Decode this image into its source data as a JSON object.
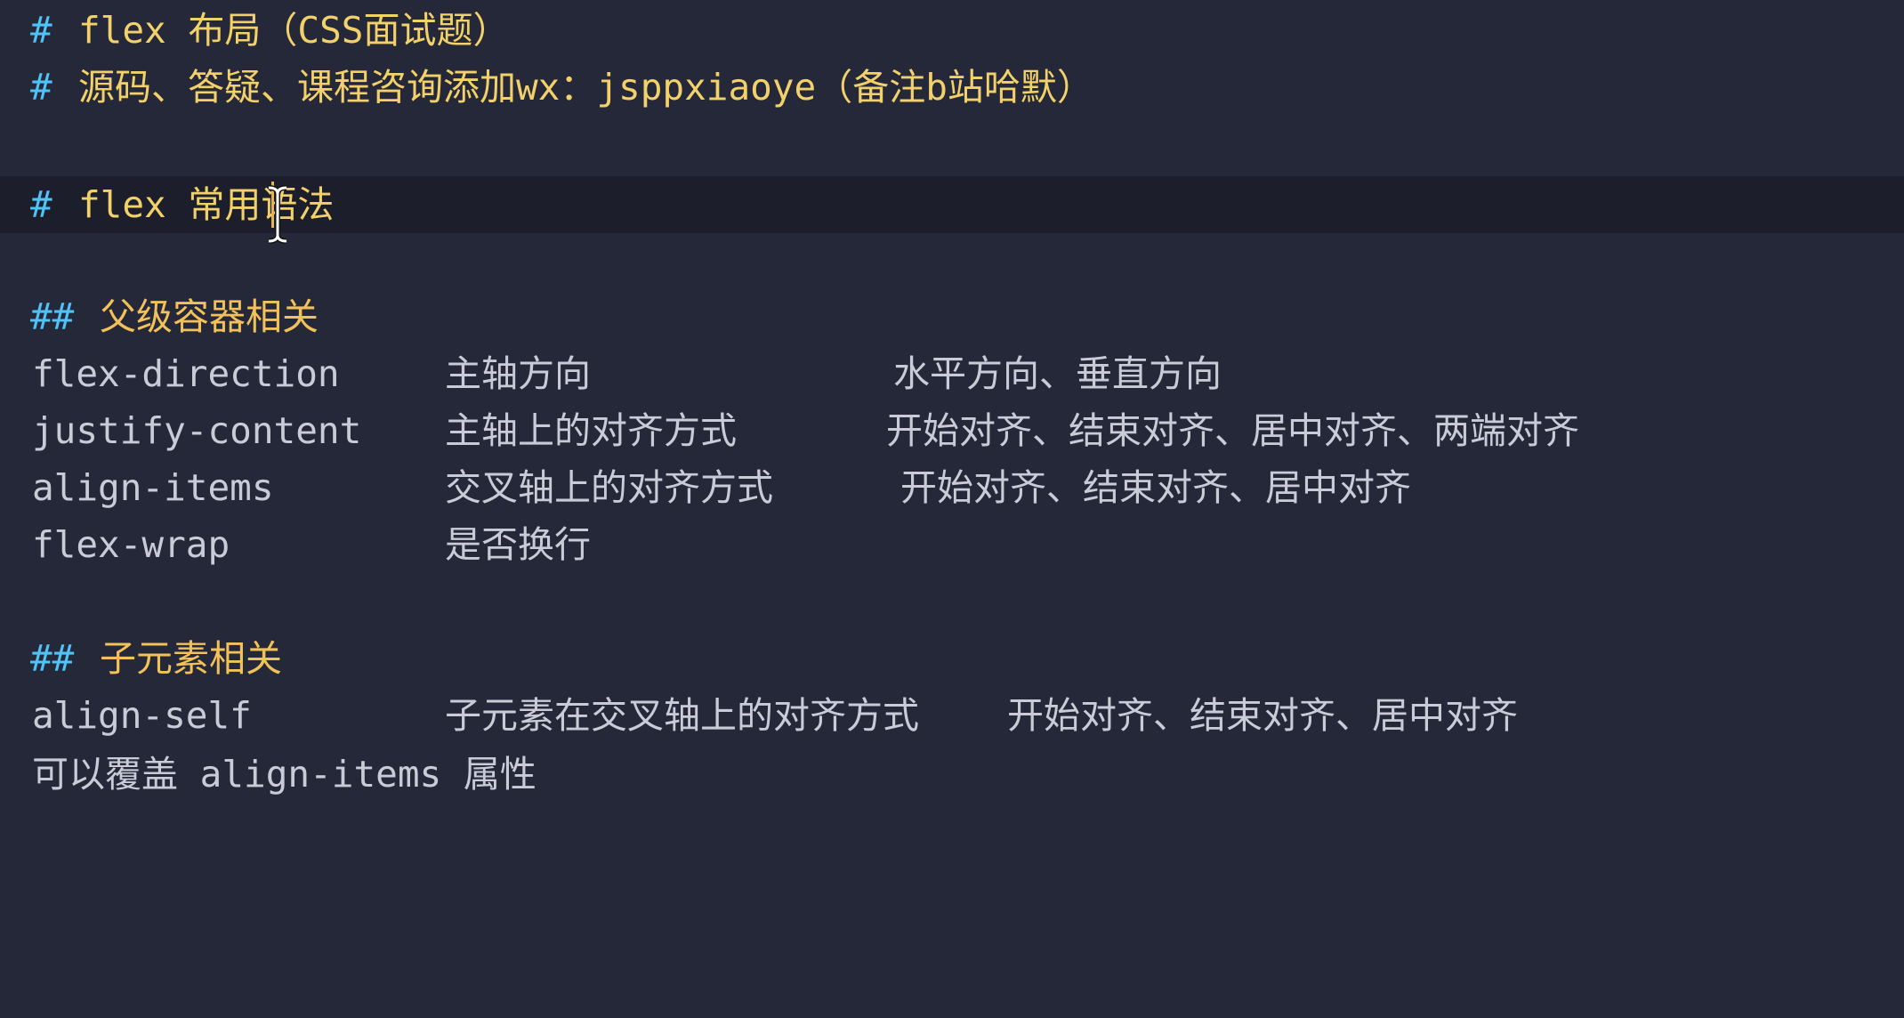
{
  "lines": {
    "title1": {
      "hash": "#",
      "text": "flex 布局（CSS面试题）"
    },
    "title2": {
      "hash": "#",
      "text": "源码、答疑、课程咨询添加wx：jsppxiaoye（备注b站哈默）"
    },
    "title3": {
      "hash": "#",
      "text": "flex 常用语法"
    },
    "section1": {
      "hash": "##",
      "text": "父级容器相关"
    },
    "section2": {
      "hash": "##",
      "text": "子元素相关"
    }
  },
  "parent_rows": [
    {
      "prop": "flex-direction",
      "desc": "主轴方向",
      "values": "水平方向、垂直方向"
    },
    {
      "prop": "justify-content",
      "desc": "主轴上的对齐方式",
      "values": "开始对齐、结束对齐、居中对齐、两端对齐"
    },
    {
      "prop": "align-items",
      "desc": "交叉轴上的对齐方式",
      "values": "开始对齐、结束对齐、居中对齐"
    },
    {
      "prop": "flex-wrap",
      "desc": "是否换行",
      "values": ""
    }
  ],
  "child_rows": [
    {
      "prop": "align-self",
      "desc": "子元素在交叉轴上的对齐方式",
      "values": "开始对齐、结束对齐、居中对齐"
    }
  ],
  "note": "可以覆盖 align-items 属性",
  "colors": {
    "background": "#252839",
    "current_line": "#1c1f2b",
    "hash": "#4fc3f7",
    "heading": "#f2d16b",
    "text": "#c9ccd6",
    "caret": "#e6b450"
  }
}
